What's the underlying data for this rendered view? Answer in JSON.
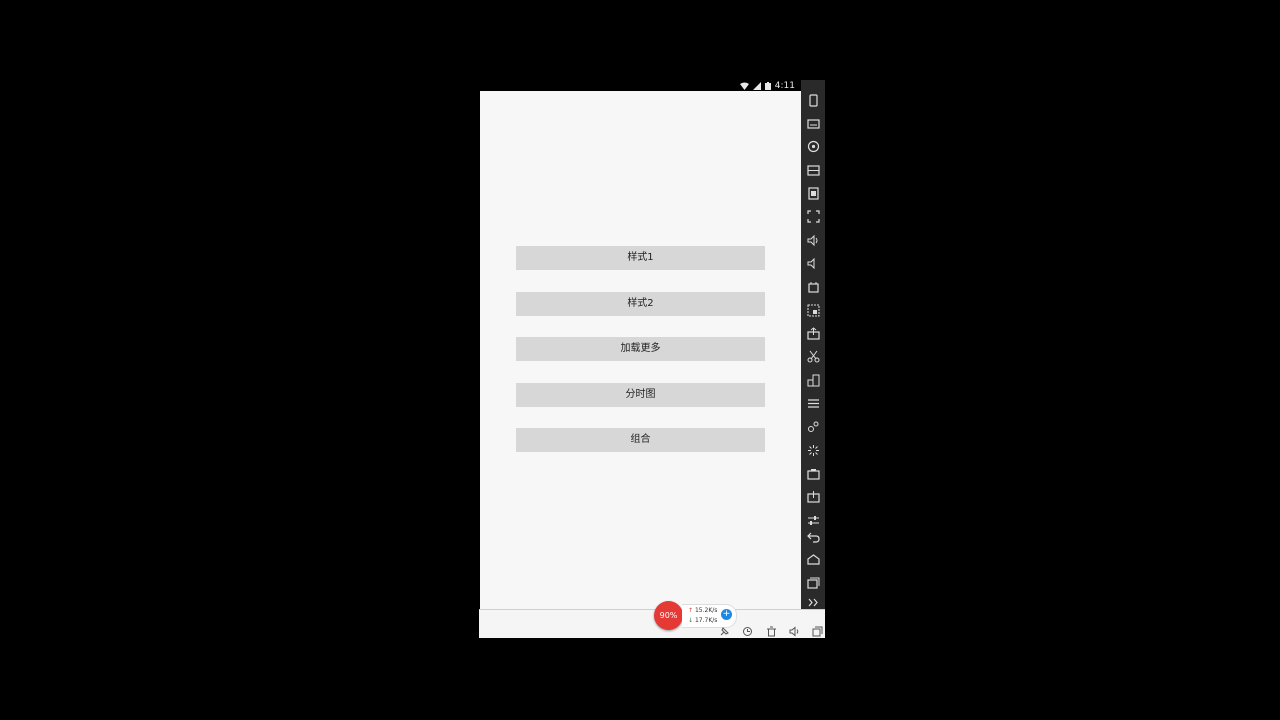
{
  "status_bar": {
    "time": "4:11",
    "icons": [
      "wifi-icon",
      "signal-icon",
      "battery-icon"
    ]
  },
  "app": {
    "buttons": [
      {
        "label": "样式1"
      },
      {
        "label": "样式2"
      },
      {
        "label": "加载更多"
      },
      {
        "label": "分时图"
      },
      {
        "label": "组合"
      }
    ]
  },
  "emulator_toolbar": {
    "icons": [
      "phone-rotate-icon",
      "keyboard-icon",
      "location-icon",
      "storage-icon",
      "sdcard-icon",
      "fullscreen-icon",
      "volume-up-icon",
      "volume-down-icon",
      "shake-icon",
      "screenshot-icon",
      "share-icon",
      "scissors-icon",
      "multi-window-icon",
      "menu-icon",
      "app-icon",
      "loading-icon",
      "camera-icon",
      "install-icon",
      "settings-slider-icon",
      "back-icon",
      "home-icon",
      "recents-icon",
      "expand-more-icon"
    ]
  },
  "taskbar": {
    "cpu_percent": "90%",
    "upload_speed": "15.2K/s",
    "download_speed": "17.7K/s",
    "tray_icons": [
      "pin-icon",
      "sync-icon",
      "trash-icon",
      "speaker-icon",
      "window-icon"
    ]
  },
  "colors": {
    "screen_background": "#f7f7f7",
    "button_background": "#d7d7d7",
    "cpu_badge": "#e53935",
    "net_plus": "#1e88e5"
  }
}
